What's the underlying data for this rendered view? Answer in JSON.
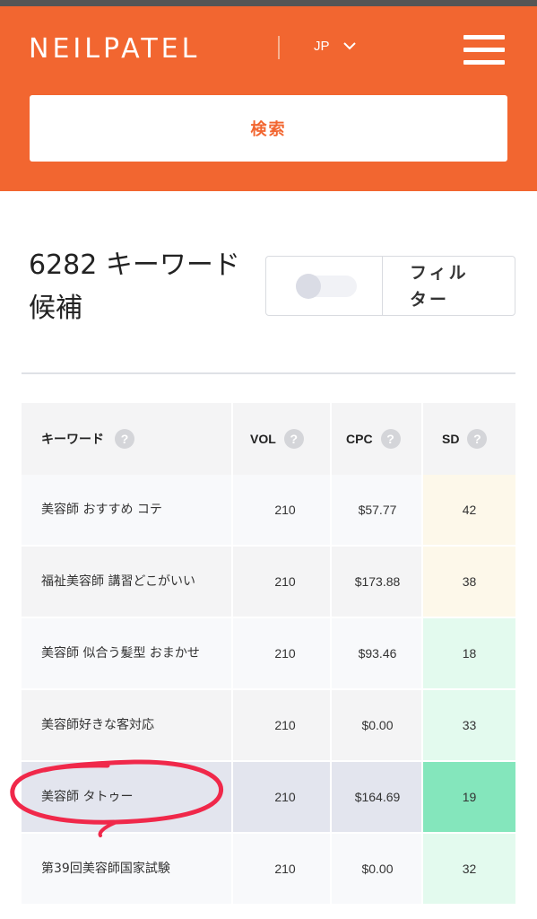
{
  "header": {
    "logo": "NEILPATEL",
    "language": "JP",
    "search_button": "検索",
    "colors": {
      "brand": "#f26630"
    }
  },
  "results": {
    "title": "6282 キーワード候補",
    "filter_label": "フィルター"
  },
  "table": {
    "columns": [
      "キーワード",
      "VOL",
      "CPC",
      "SD"
    ],
    "help_icon_text": "?",
    "rows": [
      {
        "keyword": "美容師 おすすめ コテ",
        "vol": "210",
        "cpc": "$57.77",
        "sd": "42",
        "sd_color": "#fdf8ea",
        "row_bg": "#f8f9fb"
      },
      {
        "keyword": "福祉美容師 講習どこがいい",
        "vol": "210",
        "cpc": "$173.88",
        "sd": "38",
        "sd_color": "#fdf8ea",
        "row_bg": "#f4f4f5"
      },
      {
        "keyword": "美容師 似合う髪型 おまかせ",
        "vol": "210",
        "cpc": "$93.46",
        "sd": "18",
        "sd_color": "#e3faee",
        "row_bg": "#f8f9fb"
      },
      {
        "keyword": "美容師好きな客対応",
        "vol": "210",
        "cpc": "$0.00",
        "sd": "33",
        "sd_color": "#e3faee",
        "row_bg": "#f4f4f5"
      },
      {
        "keyword": "美容師 タトゥー",
        "vol": "210",
        "cpc": "$164.69",
        "sd": "19",
        "sd_color": "#84e6bc",
        "row_bg": "#e3e5ee"
      },
      {
        "keyword": "第39回美容師国家試験",
        "vol": "210",
        "cpc": "$0.00",
        "sd": "32",
        "sd_color": "#e3faee",
        "row_bg": "#f8f9fb"
      }
    ]
  },
  "icons": {
    "menu": "hamburger-menu-icon",
    "language_chevron": "chevron-down-icon",
    "help": "help-circle-icon"
  },
  "annotation": {
    "color": "#f0284a"
  }
}
